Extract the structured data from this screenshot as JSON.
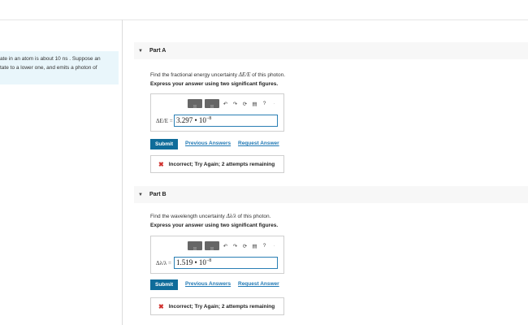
{
  "intro": {
    "line1": "ate in an atom is about 10 ns . Suppose an",
    "line2": "tate to a lower one, and emits a photon of"
  },
  "toolbar_icons": [
    "template-icon",
    "template-icon",
    "undo-icon",
    "redo-icon",
    "reset-icon",
    "keyboard-icon",
    "help-icon",
    "more-icon"
  ],
  "toolbar_glyphs": {
    "undo": "↶",
    "redo": "↷",
    "reset": "⟳",
    "keyboard": "▤",
    "help": "?",
    "more": "·"
  },
  "parts": [
    {
      "title": "Part A",
      "question_prefix": "Find the fractional energy uncertainty ",
      "question_math": "ΔE/E",
      "question_suffix": "  of this photon.",
      "instruction": "Express your answer using two significant figures.",
      "answer_label": "ΔE/E  =",
      "answer_mantissa": "3.297 • 10",
      "answer_exponent": "−8",
      "submit": "Submit",
      "previous_answers": "Previous Answers",
      "request_answer": "Request Answer",
      "feedback": "Incorrect; Try Again; 2 attempts remaining"
    },
    {
      "title": "Part B",
      "question_prefix": "Find the wavelength uncertainty ",
      "question_math": "Δλ/λ",
      "question_suffix": "  of this photon.",
      "instruction": "Express your answer using two significant figures.",
      "answer_label": "Δλ/λ  =",
      "answer_mantissa": "1.519 • 10",
      "answer_exponent": "−8",
      "submit": "Submit",
      "previous_answers": "Previous Answers",
      "request_answer": "Request Answer",
      "feedback": "Incorrect; Try Again; 2 attempts remaining"
    }
  ]
}
